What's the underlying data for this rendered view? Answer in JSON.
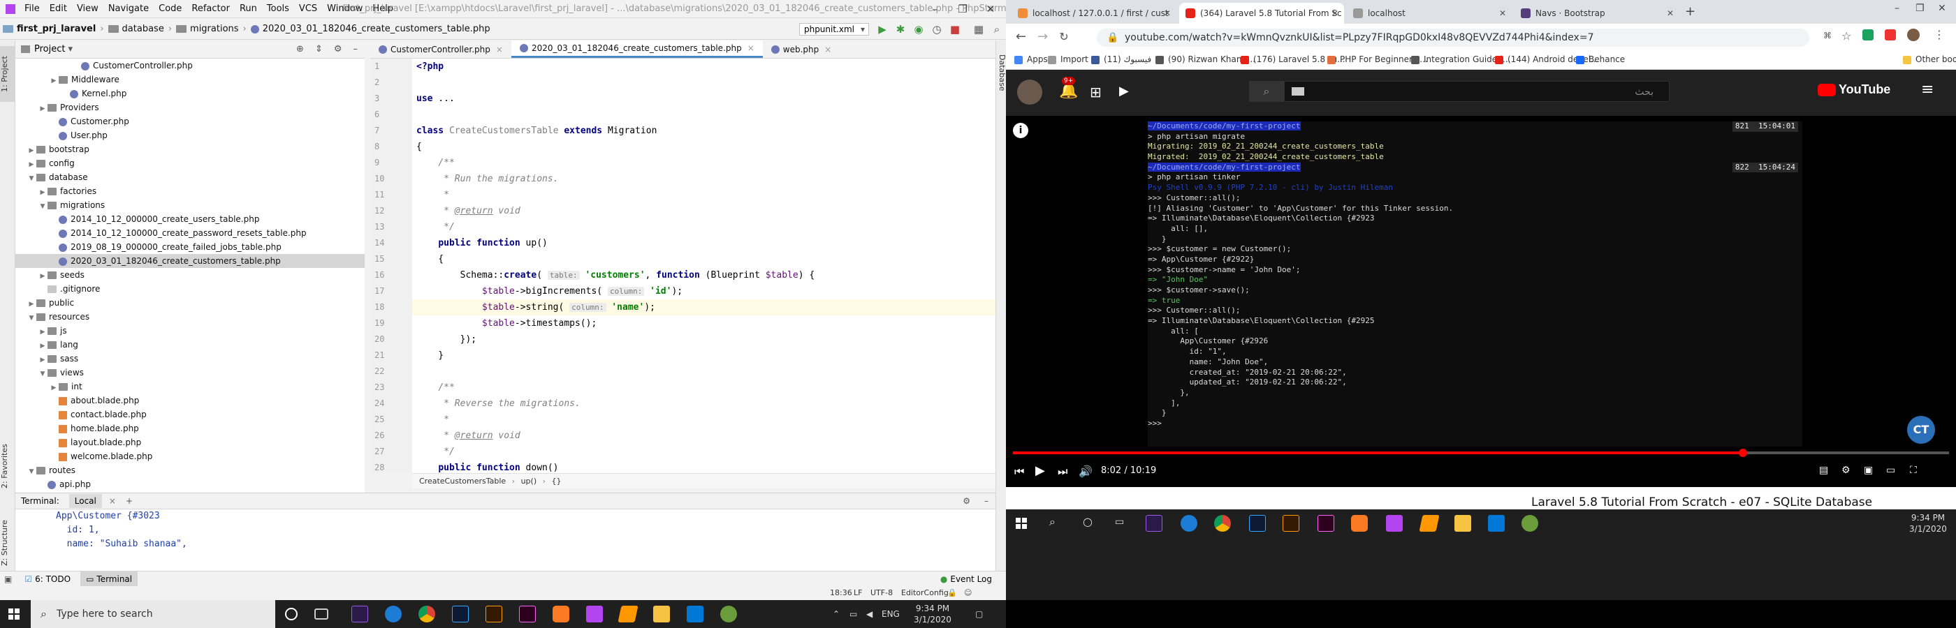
{
  "ide": {
    "title": "first_prj_laravel [E:\\xampp\\htdocs\\Laravel\\first_prj_laravel] - ...\\database\\migrations\\2020_03_01_182046_create_customers_table.php - PhpStorm",
    "menu": [
      "File",
      "Edit",
      "View",
      "Navigate",
      "Code",
      "Refactor",
      "Run",
      "Tools",
      "VCS",
      "Window",
      "Help"
    ],
    "breadcrumb": [
      "first_prj_laravel",
      "database",
      "migrations",
      "2020_03_01_182046_create_customers_table.php"
    ],
    "run_config": "phpunit.xml",
    "project_label": "Project",
    "side_labels": {
      "project": "1: Project",
      "favorites": "2: Favorites",
      "structure": "Z: Structure",
      "database": "Database"
    },
    "tree": [
      {
        "label": "CustomerController.php",
        "icon": "php",
        "depth": 5
      },
      {
        "label": "Middleware",
        "icon": "folder",
        "depth": 3,
        "arrow": ">"
      },
      {
        "label": "Kernel.php",
        "icon": "php",
        "depth": 4
      },
      {
        "label": "Providers",
        "icon": "folder",
        "depth": 2,
        "arrow": ">"
      },
      {
        "label": "Customer.php",
        "icon": "php",
        "depth": 3
      },
      {
        "label": "User.php",
        "icon": "php",
        "depth": 3
      },
      {
        "label": "bootstrap",
        "icon": "folder",
        "depth": 1,
        "arrow": ">"
      },
      {
        "label": "config",
        "icon": "folder",
        "depth": 1,
        "arrow": ">"
      },
      {
        "label": "database",
        "icon": "folder",
        "depth": 1,
        "arrow": "v"
      },
      {
        "label": "factories",
        "icon": "folder",
        "depth": 2,
        "arrow": ">"
      },
      {
        "label": "migrations",
        "icon": "folder",
        "depth": 2,
        "arrow": "v"
      },
      {
        "label": "2014_10_12_000000_create_users_table.php",
        "icon": "php",
        "depth": 3
      },
      {
        "label": "2014_10_12_100000_create_password_resets_table.php",
        "icon": "php",
        "depth": 3
      },
      {
        "label": "2019_08_19_000000_create_failed_jobs_table.php",
        "icon": "php",
        "depth": 3
      },
      {
        "label": "2020_03_01_182046_create_customers_table.php",
        "icon": "php",
        "depth": 3,
        "selected": true
      },
      {
        "label": "seeds",
        "icon": "folder",
        "depth": 2,
        "arrow": ">"
      },
      {
        "label": ".gitignore",
        "icon": "git",
        "depth": 2
      },
      {
        "label": "public",
        "icon": "folder",
        "depth": 1,
        "arrow": ">"
      },
      {
        "label": "resources",
        "icon": "folder",
        "depth": 1,
        "arrow": "v"
      },
      {
        "label": "js",
        "icon": "folder",
        "depth": 2,
        "arrow": ">"
      },
      {
        "label": "lang",
        "icon": "folder",
        "depth": 2,
        "arrow": ">"
      },
      {
        "label": "sass",
        "icon": "folder",
        "depth": 2,
        "arrow": ">"
      },
      {
        "label": "views",
        "icon": "folder",
        "depth": 2,
        "arrow": "v"
      },
      {
        "label": "int",
        "icon": "folder",
        "depth": 3,
        "arrow": ">"
      },
      {
        "label": "about.blade.php",
        "icon": "blade",
        "depth": 3
      },
      {
        "label": "contact.blade.php",
        "icon": "blade",
        "depth": 3
      },
      {
        "label": "home.blade.php",
        "icon": "blade",
        "depth": 3
      },
      {
        "label": "layout.blade.php",
        "icon": "blade",
        "depth": 3
      },
      {
        "label": "welcome.blade.php",
        "icon": "blade",
        "depth": 3
      },
      {
        "label": "routes",
        "icon": "folder",
        "depth": 1,
        "arrow": "v"
      },
      {
        "label": "api.php",
        "icon": "php",
        "depth": 2
      }
    ],
    "editor_tabs": [
      {
        "label": "CustomerController.php",
        "active": false
      },
      {
        "label": "2020_03_01_182046_create_customers_table.php",
        "active": true
      },
      {
        "label": "web.php",
        "active": false
      }
    ],
    "code_lines": [
      {
        "n": "1",
        "html": "<span class=\"kw\">&lt;?php</span>"
      },
      {
        "n": "2",
        "html": ""
      },
      {
        "n": "3",
        "html": "<span class=\"kw\">use</span> ..."
      },
      {
        "n": "6",
        "html": ""
      },
      {
        "n": "7",
        "html": "<span class=\"kw\">class</span> <span class=\"cls\">CreateCustomersTable</span> <span class=\"kw\">extends</span> Migration"
      },
      {
        "n": "8",
        "html": "{"
      },
      {
        "n": "9",
        "html": "    <span class=\"cmt\">/**</span>"
      },
      {
        "n": "10",
        "html": "     <span class=\"cmt\">* Run the migrations.</span>"
      },
      {
        "n": "11",
        "html": "     <span class=\"cmt\">*</span>"
      },
      {
        "n": "12",
        "html": "     <span class=\"cmt\">* </span><span class=\"doctag\">@return</span> <span class=\"cmt\">void</span>"
      },
      {
        "n": "13",
        "html": "     <span class=\"cmt\">*/</span>"
      },
      {
        "n": "14",
        "html": "    <span class=\"kw\">public function</span> up()"
      },
      {
        "n": "15",
        "html": "    {"
      },
      {
        "n": "16",
        "html": "        Schema::<span class=\"kw\">create</span>( <span class=\"hint\">table:</span> <span class=\"str\">'customers'</span>, <span class=\"kw\">function</span> (Blueprint <span class=\"var\">$table</span>) {"
      },
      {
        "n": "17",
        "html": "            <span class=\"var\">$table</span>-&gt;bigIncrements( <span class=\"hint\">column:</span> <span class=\"str\">'id'</span>);"
      },
      {
        "n": "18",
        "html": "            <span class=\"var\">$table</span>-&gt;string( <span class=\"hint\">column:</span> <span class=\"str\">'name'</span>);",
        "cur": true
      },
      {
        "n": "19",
        "html": "            <span class=\"var\">$table</span>-&gt;timestamps();"
      },
      {
        "n": "20",
        "html": "        });"
      },
      {
        "n": "21",
        "html": "    }"
      },
      {
        "n": "22",
        "html": ""
      },
      {
        "n": "23",
        "html": "    <span class=\"cmt\">/**</span>"
      },
      {
        "n": "24",
        "html": "     <span class=\"cmt\">* Reverse the migrations.</span>"
      },
      {
        "n": "25",
        "html": "     <span class=\"cmt\">*</span>"
      },
      {
        "n": "26",
        "html": "     <span class=\"cmt\">* </span><span class=\"doctag\">@return</span> <span class=\"cmt\">void</span>"
      },
      {
        "n": "27",
        "html": "     <span class=\"cmt\">*/</span>"
      },
      {
        "n": "28",
        "html": "    <span class=\"kw\">public function</span> down()"
      }
    ],
    "code_breadcrumb": [
      "CreateCustomersTable",
      "up()",
      "{}"
    ],
    "terminal": {
      "header": "Terminal:",
      "tab": "Local",
      "lines": [
        "App\\Customer {#3023",
        "  id: 1,",
        "  name: \"Suhaib shanaa\","
      ]
    },
    "bottom_tabs": [
      "6: TODO",
      "Terminal"
    ],
    "event_log": "Event Log",
    "status": {
      "pos": "18:36",
      "le": "LF",
      "enc": "UTF-8",
      "cfg": "EditorConfig"
    }
  },
  "taskbar_left": {
    "search_placeholder": "Type here to search",
    "time": "9:34 PM",
    "date": "3/1/2020",
    "lang": "ENG"
  },
  "taskbar_right": {
    "time": "9:34 PM",
    "date": "3/1/2020"
  },
  "browser": {
    "tabs": [
      {
        "label": "localhost / 127.0.0.1 / first / cust",
        "color": "#f08d39"
      },
      {
        "label": "(364) Laravel 5.8 Tutorial From Sc",
        "color": "#e62117",
        "active": true
      },
      {
        "label": "localhost",
        "color": "#999999"
      },
      {
        "label": "Navs · Bootstrap",
        "color": "#563d7c"
      }
    ],
    "url": "youtube.com/watch?v=kWmnQvznkUI&list=PLpzy7FIRqpGD0kxI48v8QEVVZd744Phi4&index=7",
    "bookmarks": [
      {
        "label": "Apps",
        "color": "#4285f4"
      },
      {
        "label": "Import",
        "color": "#999999"
      },
      {
        "label": "فيسبوك (11)",
        "color": "#3b5998"
      },
      {
        "label": "(90) Rizwan Khan -...",
        "color": "#555555"
      },
      {
        "label": "(176) Laravel 5.8 Tu...",
        "color": "#e62117"
      },
      {
        "label": "PHP For Beginners:...",
        "color": "#e36d3d"
      },
      {
        "label": "Integration Guide |...",
        "color": "#555555"
      },
      {
        "label": "(144) Android devel...",
        "color": "#e62117"
      },
      {
        "label": "Behance",
        "color": "#1769ff"
      },
      {
        "label": "Other bookmarks",
        "color": "#f4c542"
      }
    ],
    "yt_search_placeholder": "بحث",
    "yt_logo": "YouTube",
    "yt_badge": "9+",
    "video_time": "8:02 / 10:19",
    "progress": 0.78,
    "below_title": "Laravel 5.8 Tutorial From Scratch - e07 - SQLite Database",
    "channel_badge": "CT"
  },
  "video_terminal": [
    {
      "t": "~/Documents/code/my-first-project",
      "cls": "pathbar",
      "badge": "821  15:04:01"
    },
    {
      "t": "> php artisan migrate"
    },
    {
      "t": "Migrating: 2019_02_21_200244_create_customers_table",
      "cls": "y"
    },
    {
      "t": "Migrated:  2019_02_21_200244_create_customers_table",
      "cls": "y"
    },
    {
      "t": "~/Documents/code/my-first-project",
      "cls": "pathbar",
      "badge": "822  15:04:24"
    },
    {
      "t": "> php artisan tinker"
    },
    {
      "t": "Psy Shell v0.9.9 (PHP 7.2.10 - cli) by Justin Hileman",
      "cls": "bl"
    },
    {
      "t": ">>> Customer::all();"
    },
    {
      "t": "[!] Aliasing 'Customer' to 'App\\Customer' for this Tinker session."
    },
    {
      "t": "=> Illuminate\\Database\\Eloquent\\Collection {#2923"
    },
    {
      "t": "     all: [],"
    },
    {
      "t": "   }"
    },
    {
      "t": ">>> $customer = new Customer();"
    },
    {
      "t": "=> App\\Customer {#2922}"
    },
    {
      "t": ">>> $customer->name = 'John Doe';"
    },
    {
      "t": "=> \"John Doe\"",
      "cls": "g"
    },
    {
      "t": ">>> $customer->save();"
    },
    {
      "t": "=> true",
      "cls": "g"
    },
    {
      "t": ">>> Customer::all();"
    },
    {
      "t": "=> Illuminate\\Database\\Eloquent\\Collection {#2925"
    },
    {
      "t": "     all: ["
    },
    {
      "t": "       App\\Customer {#2926"
    },
    {
      "t": "         id: \"1\","
    },
    {
      "t": "         name: \"John Doe\","
    },
    {
      "t": "         created_at: \"2019-02-21 20:06:22\","
    },
    {
      "t": "         updated_at: \"2019-02-21 20:06:22\","
    },
    {
      "t": "       },"
    },
    {
      "t": "     ],"
    },
    {
      "t": "   }"
    },
    {
      "t": ">>> "
    }
  ]
}
